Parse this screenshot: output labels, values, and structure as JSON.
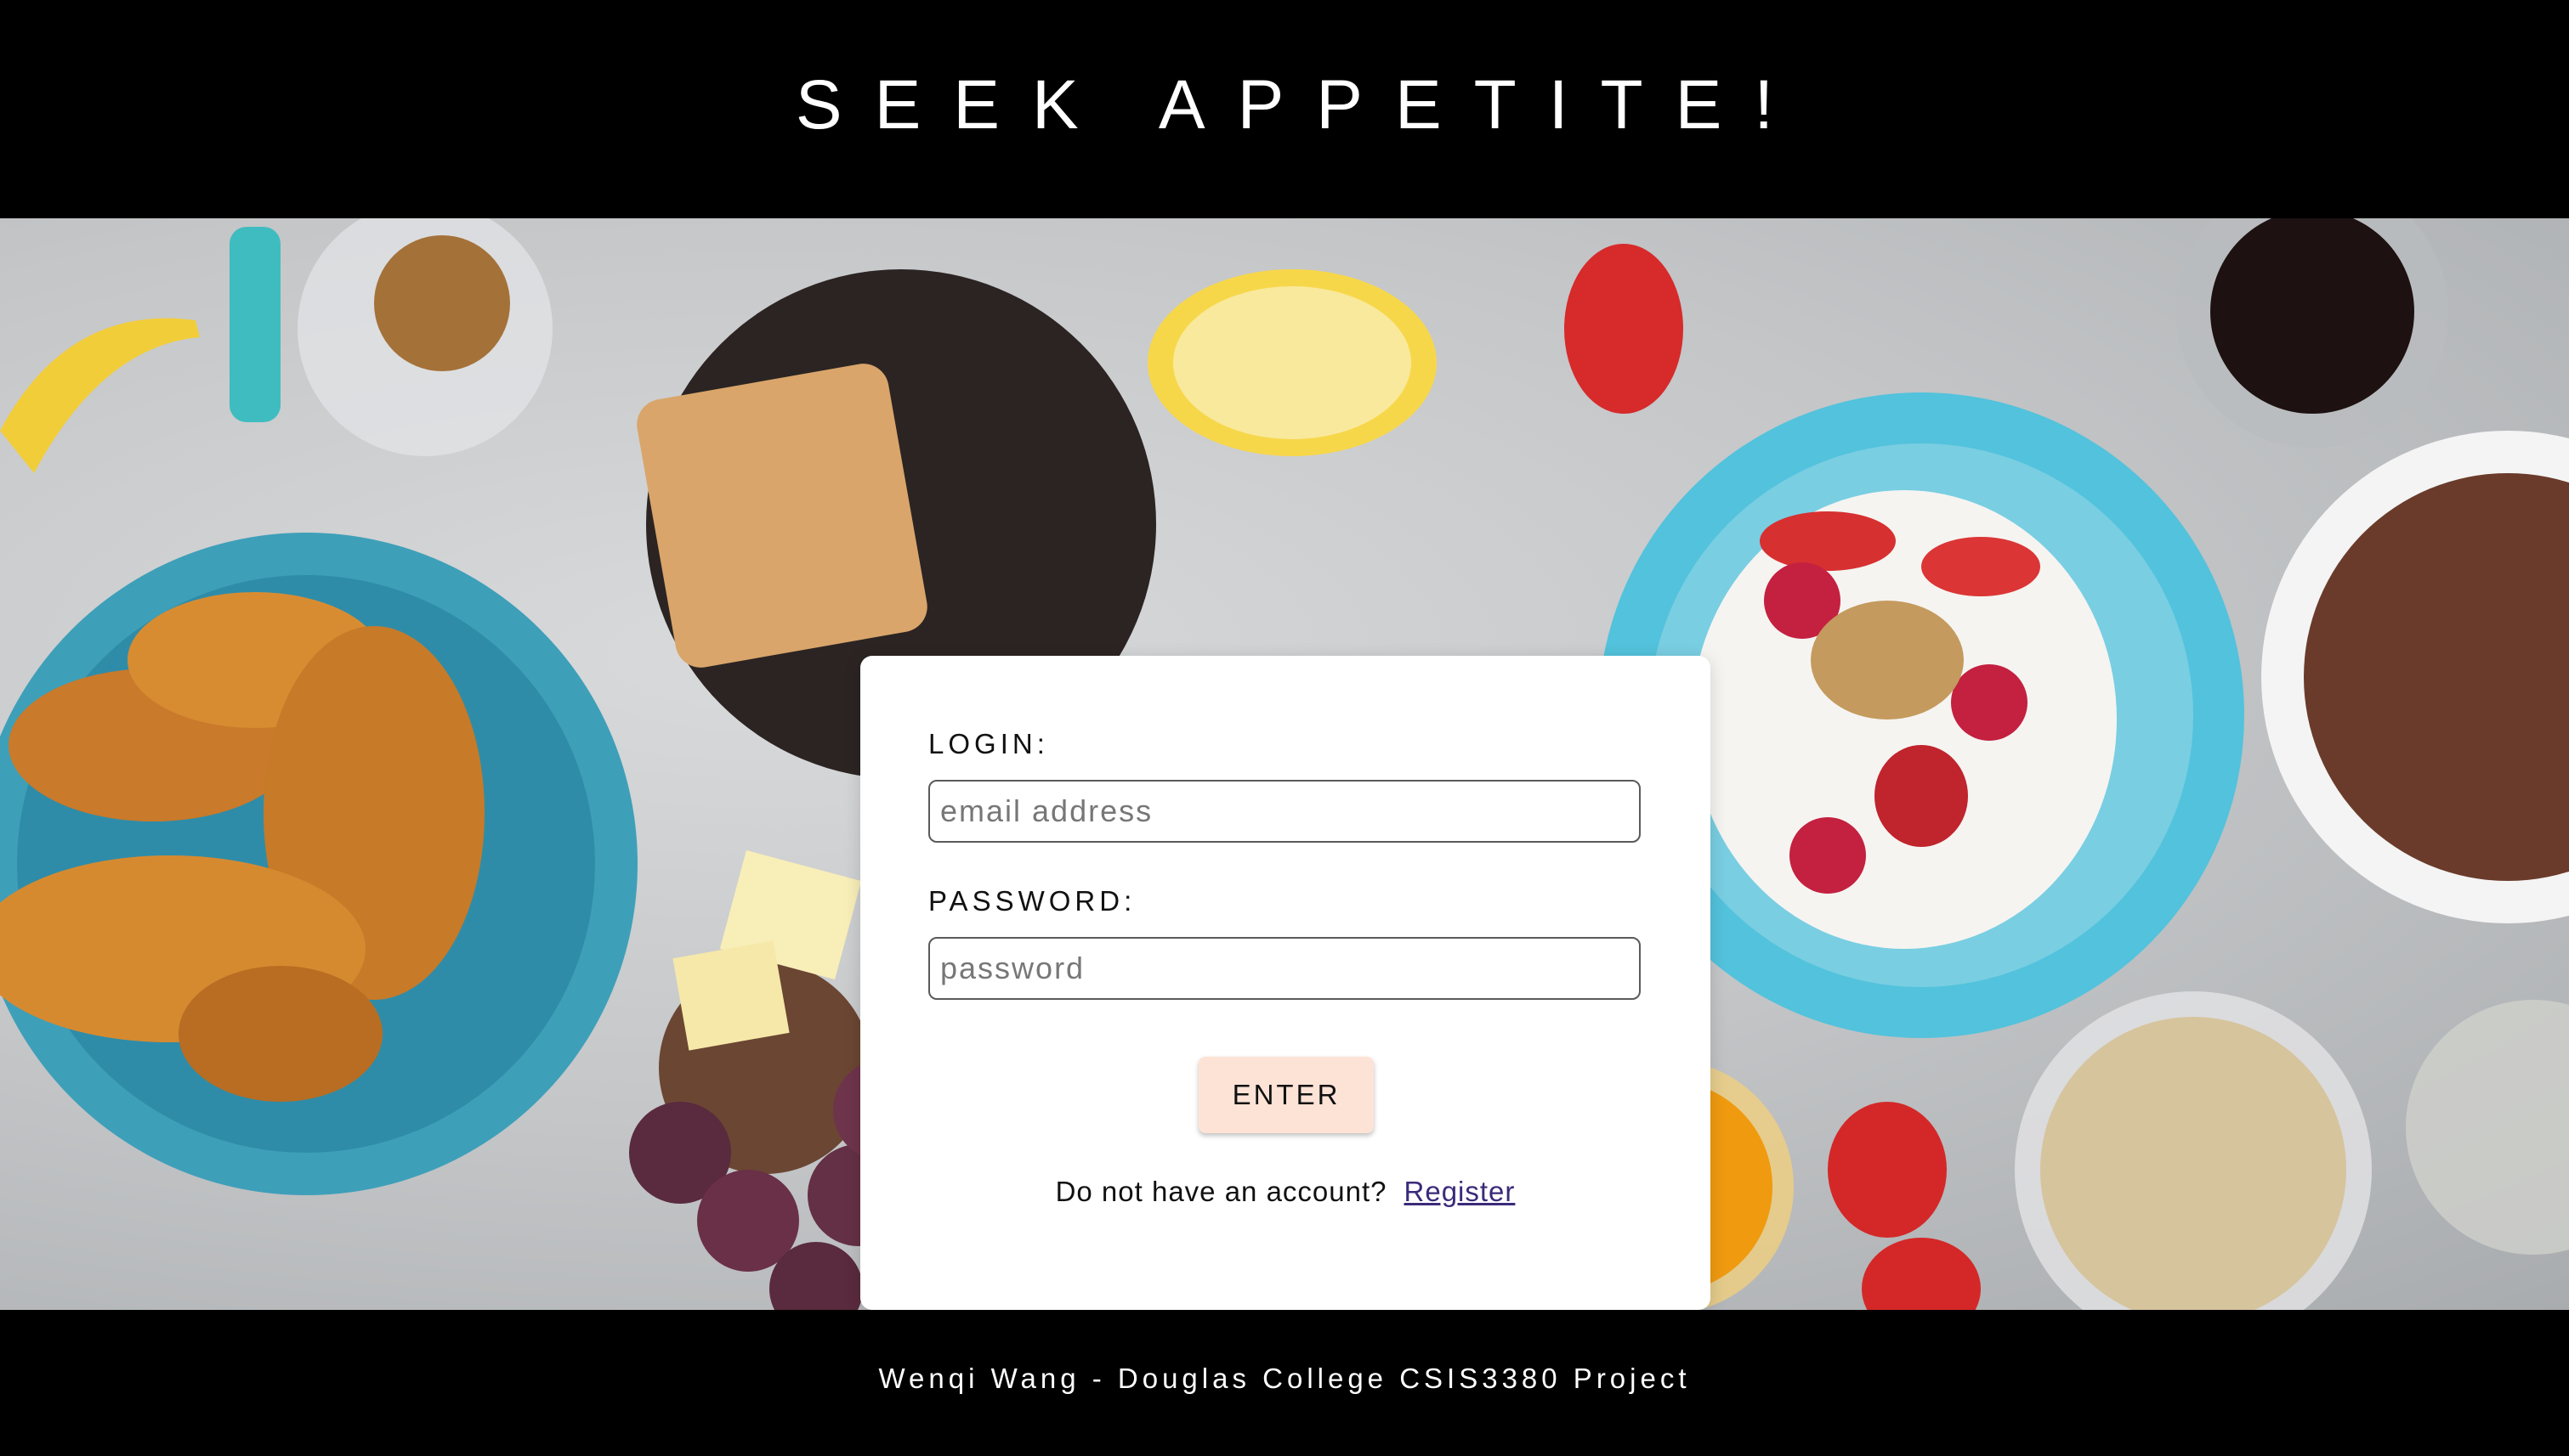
{
  "header": {
    "title": "SEEK APPETITE!"
  },
  "hero": {
    "image_description": "breakfast-spread-background"
  },
  "login_form": {
    "login_label": "LOGIN:",
    "email_placeholder": "email address",
    "email_value": "",
    "password_label": "PASSWORD:",
    "password_placeholder": "password",
    "password_value": "",
    "enter_label": "ENTER",
    "register_prompt": "Do not have an account?",
    "register_link": "Register"
  },
  "footer": {
    "text": "Wenqi Wang - Douglas College CSIS3380 Project"
  },
  "colors": {
    "header_bg": "#000000",
    "card_bg": "#ffffff",
    "button_bg": "#fde3d6",
    "link": "#3b2a7a"
  }
}
